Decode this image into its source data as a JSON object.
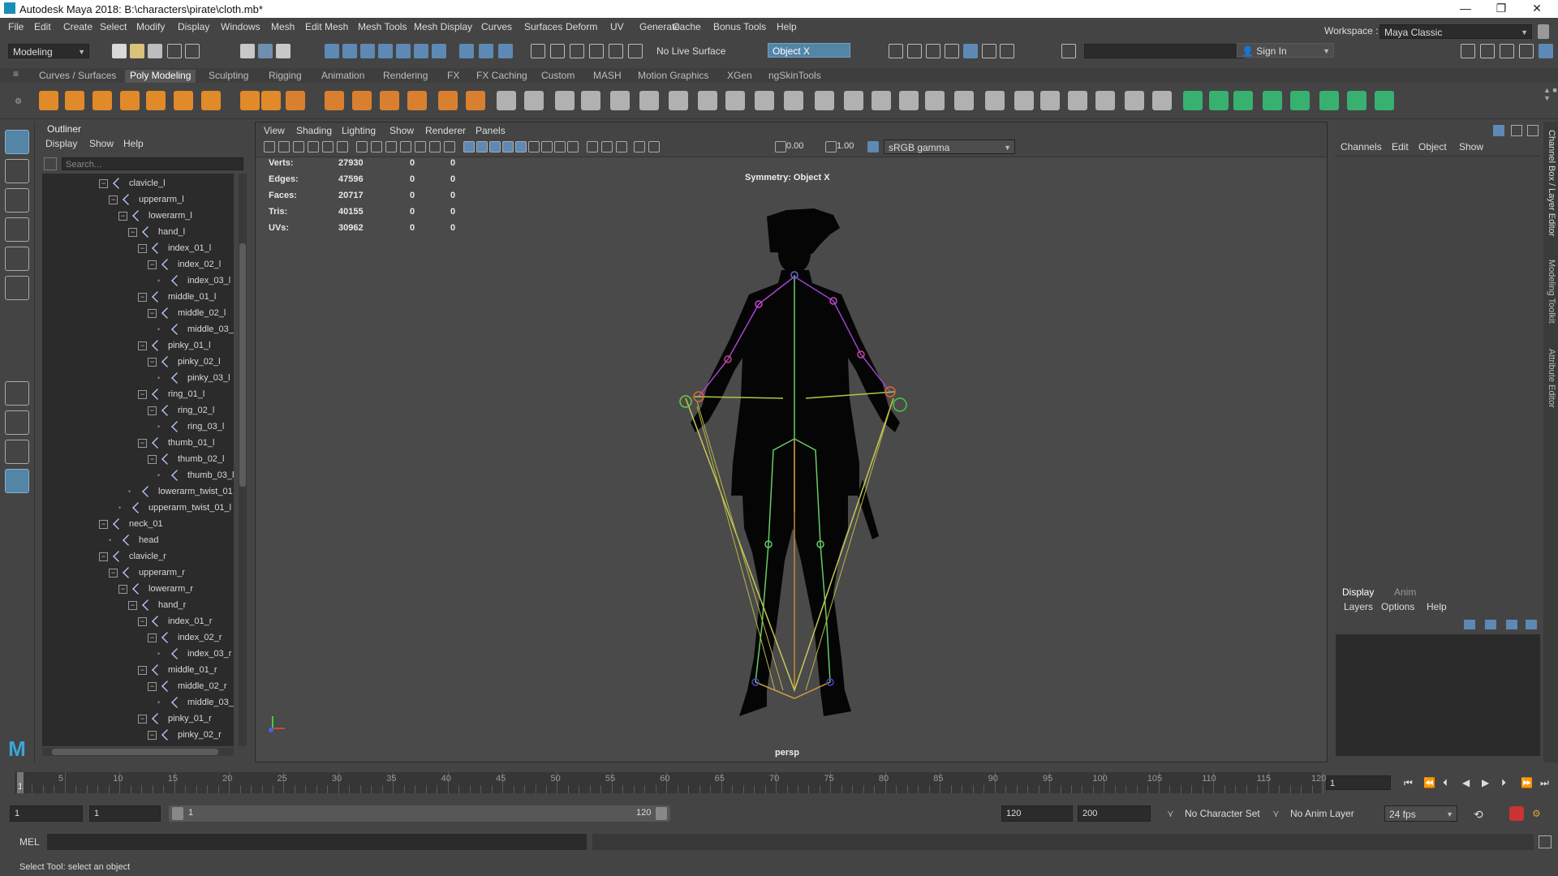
{
  "window": {
    "title": "Autodesk Maya 2018: B:\\characters\\pirate\\cloth.mb*",
    "minimize": "—",
    "maximize": "❐",
    "close": "✕"
  },
  "menu": [
    "File",
    "Edit",
    "Create",
    "Select",
    "Modify",
    "Display",
    "Windows",
    "Mesh",
    "Edit Mesh",
    "Mesh Tools",
    "Mesh Display",
    "Curves",
    "Surfaces",
    "Deform",
    "UV",
    "Generate",
    "Cache",
    "Bonus Tools",
    "Help"
  ],
  "status": {
    "mode": "Modeling",
    "live_surface": "No Live Surface",
    "symmetry": "Object X",
    "sign_in": "Sign In",
    "workspace_label": "Workspace :",
    "workspace": "Maya Classic"
  },
  "shelf_tabs": [
    "Curves / Surfaces",
    "Poly Modeling",
    "Sculpting",
    "Rigging",
    "Animation",
    "Rendering",
    "FX",
    "FX Caching",
    "Custom",
    "MASH",
    "Motion Graphics",
    "XGen",
    "ngSkinTools"
  ],
  "outliner": {
    "title": "Outliner",
    "menu": [
      "Display",
      "Show",
      "Help"
    ],
    "search_placeholder": "Search...",
    "nodes": [
      {
        "label": "clavicle_l",
        "d": 0,
        "e": true
      },
      {
        "label": "upperarm_l",
        "d": 1,
        "e": true
      },
      {
        "label": "lowerarm_l",
        "d": 2,
        "e": true
      },
      {
        "label": "hand_l",
        "d": 3,
        "e": true
      },
      {
        "label": "index_01_l",
        "d": 4,
        "e": true
      },
      {
        "label": "index_02_l",
        "d": 5,
        "e": true
      },
      {
        "label": "index_03_l",
        "d": 6,
        "e": false
      },
      {
        "label": "middle_01_l",
        "d": 4,
        "e": true
      },
      {
        "label": "middle_02_l",
        "d": 5,
        "e": true
      },
      {
        "label": "middle_03_",
        "d": 6,
        "e": false
      },
      {
        "label": "pinky_01_l",
        "d": 4,
        "e": true
      },
      {
        "label": "pinky_02_l",
        "d": 5,
        "e": true
      },
      {
        "label": "pinky_03_l",
        "d": 6,
        "e": false
      },
      {
        "label": "ring_01_l",
        "d": 4,
        "e": true
      },
      {
        "label": "ring_02_l",
        "d": 5,
        "e": true
      },
      {
        "label": "ring_03_l",
        "d": 6,
        "e": false
      },
      {
        "label": "thumb_01_l",
        "d": 4,
        "e": true
      },
      {
        "label": "thumb_02_l",
        "d": 5,
        "e": true
      },
      {
        "label": "thumb_03_l",
        "d": 6,
        "e": false
      },
      {
        "label": "lowerarm_twist_01",
        "d": 3,
        "e": false
      },
      {
        "label": "upperarm_twist_01_l",
        "d": 2,
        "e": false
      },
      {
        "label": "neck_01",
        "d": 0,
        "e": true
      },
      {
        "label": "head",
        "d": 1,
        "e": false
      },
      {
        "label": "clavicle_r",
        "d": 0,
        "e": true
      },
      {
        "label": "upperarm_r",
        "d": 1,
        "e": true
      },
      {
        "label": "lowerarm_r",
        "d": 2,
        "e": true
      },
      {
        "label": "hand_r",
        "d": 3,
        "e": true
      },
      {
        "label": "index_01_r",
        "d": 4,
        "e": true
      },
      {
        "label": "index_02_r",
        "d": 5,
        "e": true
      },
      {
        "label": "index_03_r",
        "d": 6,
        "e": false
      },
      {
        "label": "middle_01_r",
        "d": 4,
        "e": true
      },
      {
        "label": "middle_02_r",
        "d": 5,
        "e": true
      },
      {
        "label": "middle_03_",
        "d": 6,
        "e": false
      },
      {
        "label": "pinky_01_r",
        "d": 4,
        "e": true
      },
      {
        "label": "pinky_02_r",
        "d": 5,
        "e": true
      }
    ]
  },
  "viewport": {
    "menu": [
      "View",
      "Shading",
      "Lighting",
      "Show",
      "Renderer",
      "Panels"
    ],
    "exposure": "0.00",
    "gamma": "1.00",
    "color_space": "sRGB gamma",
    "symmetry_label": "Symmetry: Object X",
    "camera": "persp",
    "hud": [
      {
        "label": "Verts:",
        "v1": "27930",
        "v2": "0",
        "v3": "0"
      },
      {
        "label": "Edges:",
        "v1": "47596",
        "v2": "0",
        "v3": "0"
      },
      {
        "label": "Faces:",
        "v1": "20717",
        "v2": "0",
        "v3": "0"
      },
      {
        "label": "Tris:",
        "v1": "40155",
        "v2": "0",
        "v3": "0"
      },
      {
        "label": "UVs:",
        "v1": "30962",
        "v2": "0",
        "v3": "0"
      }
    ]
  },
  "channel_box": {
    "menu": [
      "Channels",
      "Edit",
      "Object",
      "Show"
    ],
    "layer_tabs": [
      "Display",
      "Anim"
    ],
    "layer_menu": [
      "Layers",
      "Options",
      "Help"
    ],
    "side_tabs": [
      "Channel Box / Layer Editor",
      "Modeling Toolkit",
      "Attribute Editor"
    ]
  },
  "timeline": {
    "ticks": [
      "5",
      "10",
      "15",
      "20",
      "25",
      "30",
      "35",
      "40",
      "45",
      "50",
      "55",
      "60",
      "65",
      "70",
      "75",
      "80",
      "85",
      "90",
      "95",
      "100",
      "105",
      "110",
      "115",
      "120"
    ],
    "start_label": "1",
    "current_frame": "1"
  },
  "range": {
    "start": "1",
    "playback_start": "1",
    "range_start": "1",
    "range_end": "120",
    "playback_end": "120",
    "end": "200",
    "character_set": "No Character Set",
    "anim_layer": "No Anim Layer",
    "fps": "24 fps"
  },
  "command": {
    "label": "MEL"
  },
  "help_line": "Select Tool: select an object",
  "colors": {
    "accent": "#5285a6",
    "highlight": "#78a0c8"
  }
}
